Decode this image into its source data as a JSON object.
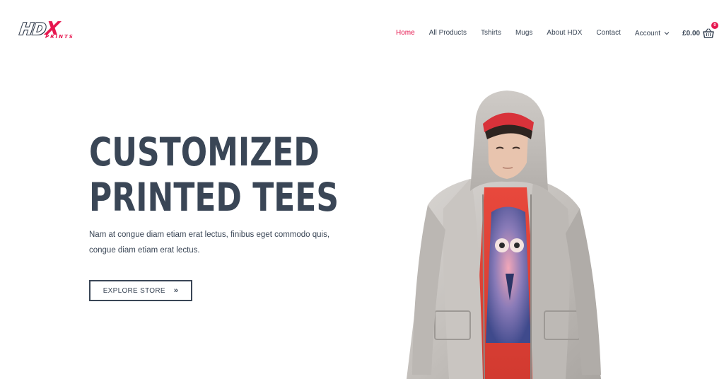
{
  "brand": {
    "logo_main_a": "HD",
    "logo_main_b": "X",
    "logo_sub": "PRINTS"
  },
  "nav": {
    "items": [
      {
        "label": "Home",
        "active": true
      },
      {
        "label": "All Products"
      },
      {
        "label": "Tshirts"
      },
      {
        "label": "Mugs"
      },
      {
        "label": "About HDX"
      },
      {
        "label": "Contact"
      }
    ],
    "account_label": "Account",
    "cart_total": "£0.00",
    "cart_count": "0"
  },
  "hero": {
    "title_line1": "CUSTOMIZED",
    "title_line2": "PRINTED TEES",
    "text_line1": "Nam at congue diam etiam erat lectus, finibus eget commodo quis,",
    "text_line2": "congue diam etiam erat lectus.",
    "button_label": "EXPLORE STORE",
    "button_arrow": "»"
  },
  "colors": {
    "accent": "#e6174f",
    "text": "#3a4656",
    "background": "#ffffff"
  },
  "icons": {
    "account_chevron": "chevron-down-icon",
    "cart": "shopping-basket-icon"
  }
}
